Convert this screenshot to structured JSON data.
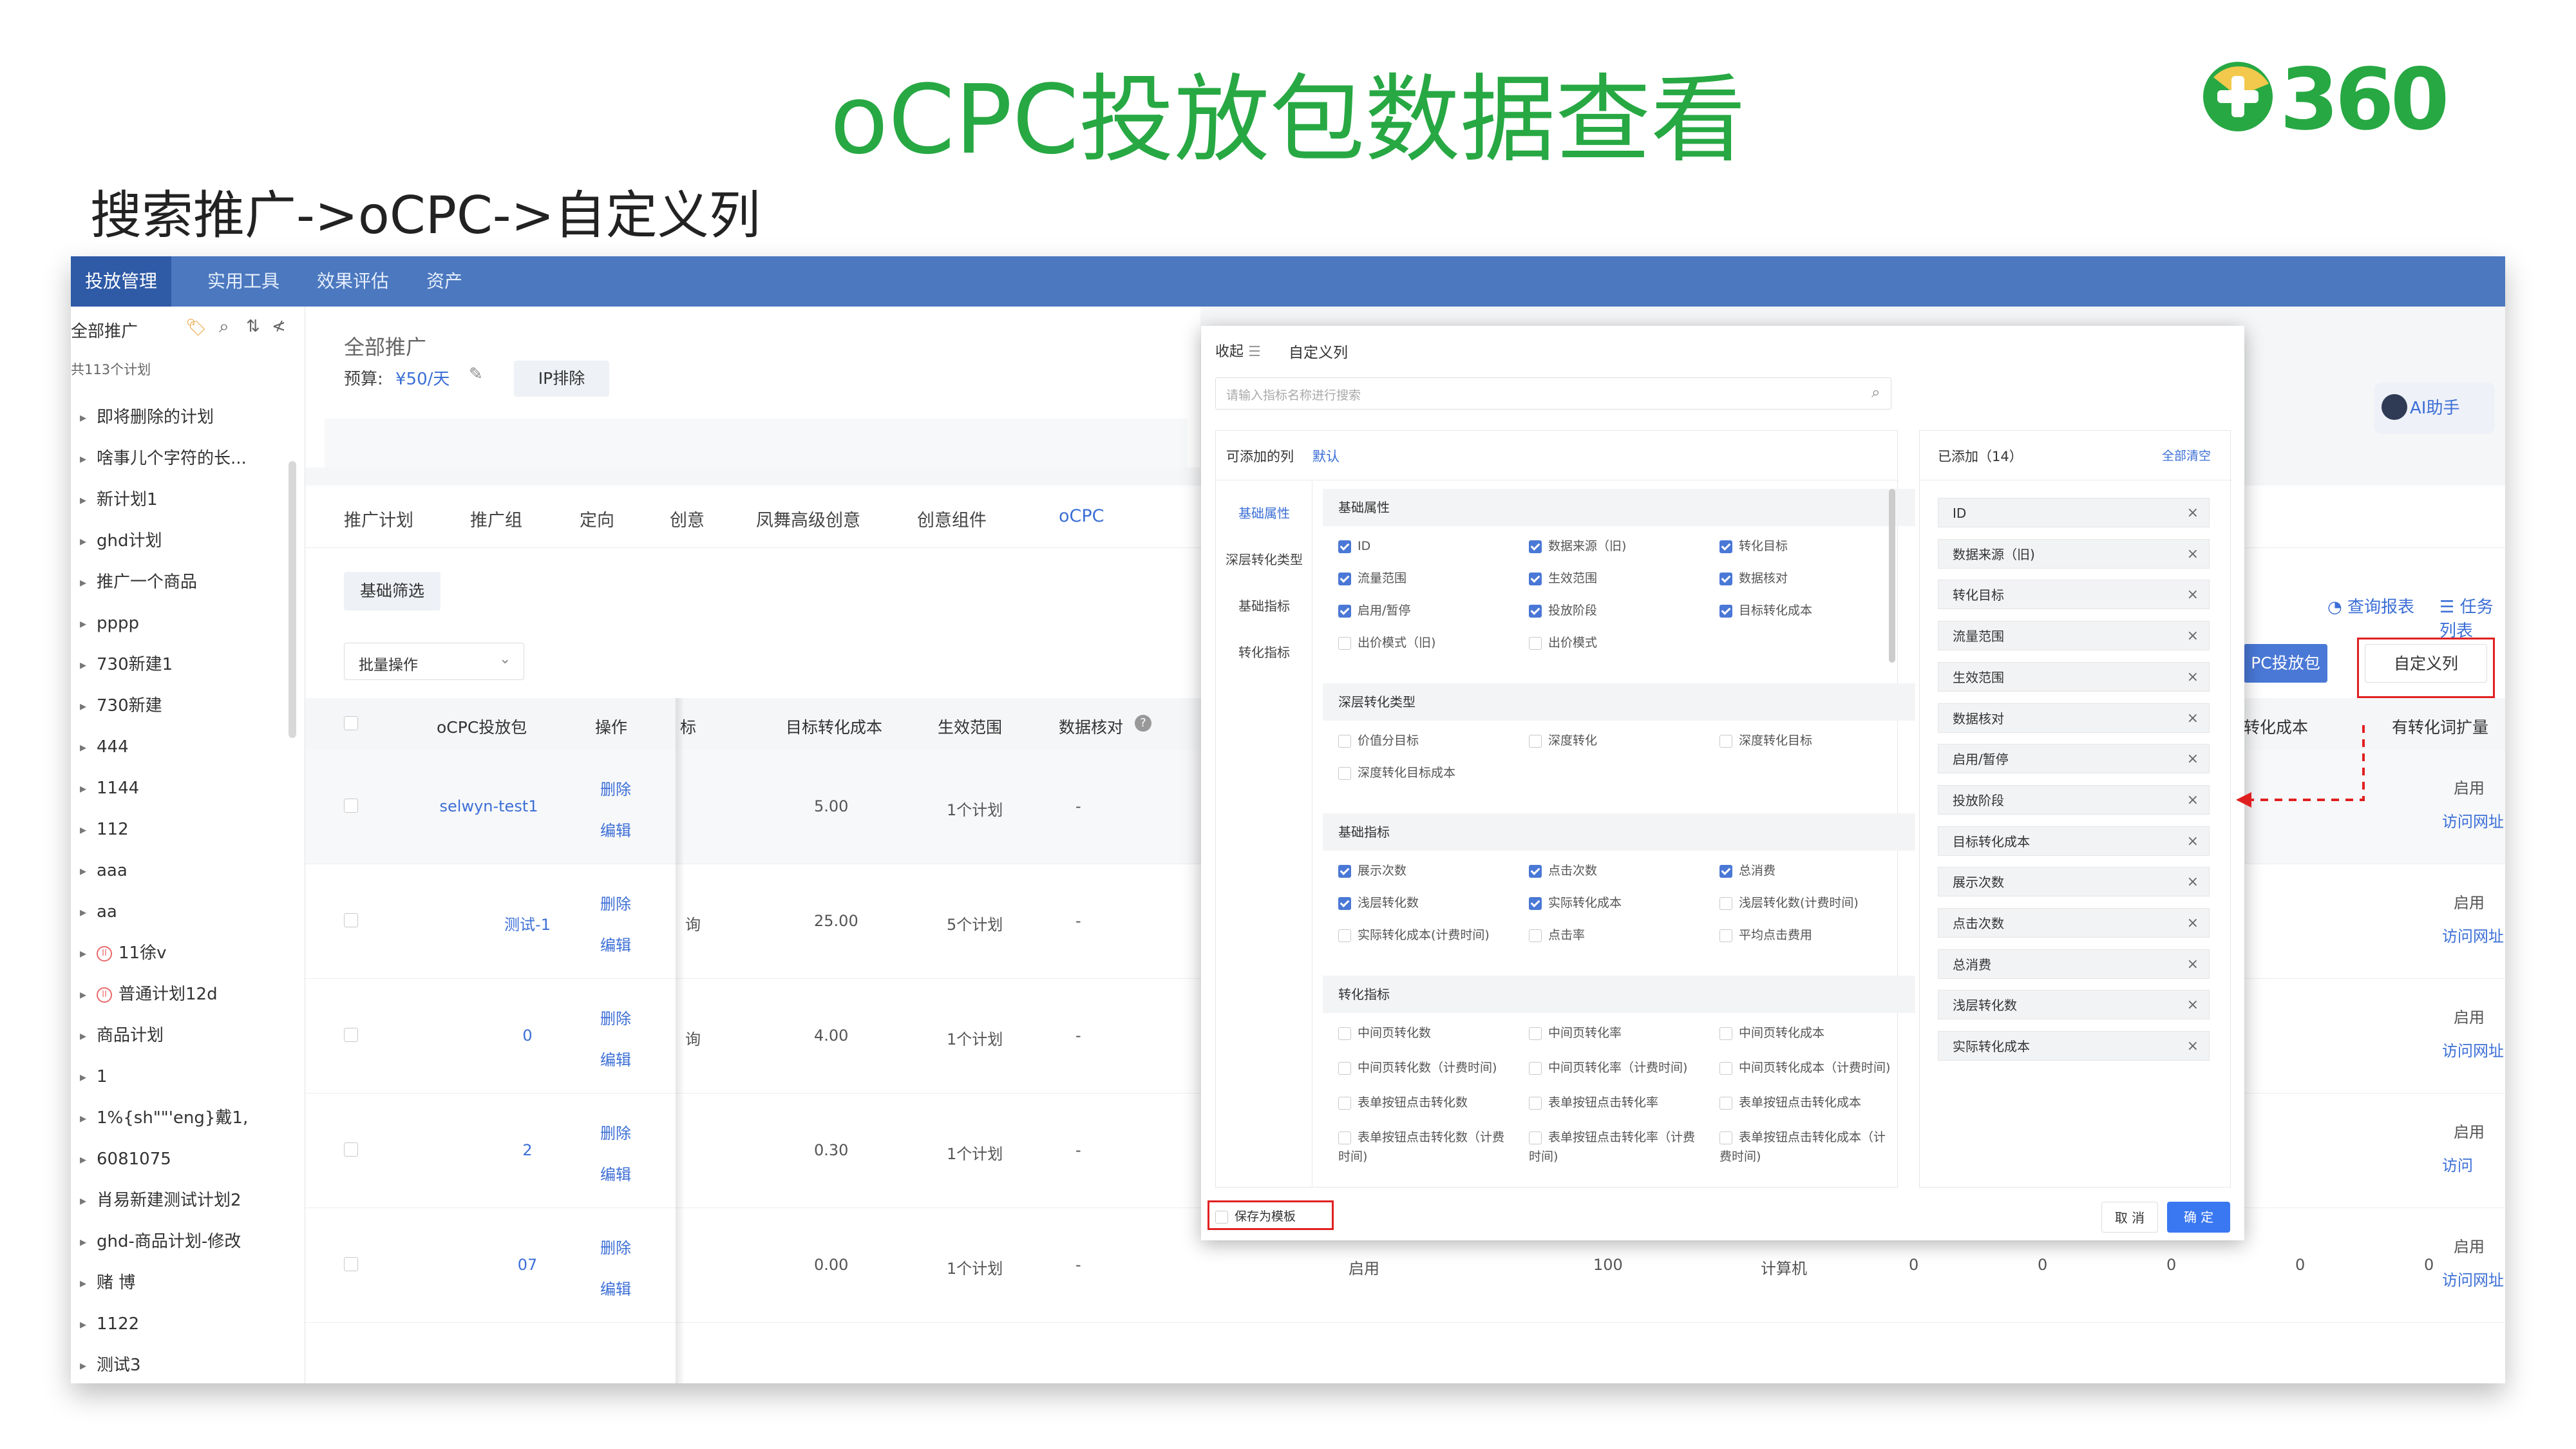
{
  "slide": {
    "title": "oCPC投放包数据查看",
    "logo_text": "360",
    "subtitle": "搜索推广->oCPC->自定义列"
  },
  "topnav": [
    "投放管理",
    "实用工具",
    "效果评估",
    "资产"
  ],
  "sidebar": {
    "title": "全部推广",
    "count": "共113个计划",
    "items": [
      {
        "label": "即将删除的计划"
      },
      {
        "label": "啥事儿个字符的长..."
      },
      {
        "label": "新计划1"
      },
      {
        "label": "ghd计划"
      },
      {
        "label": "推广一个商品"
      },
      {
        "label": "pppp"
      },
      {
        "label": "730新建1"
      },
      {
        "label": "730新建"
      },
      {
        "label": "444"
      },
      {
        "label": "1144"
      },
      {
        "label": "112"
      },
      {
        "label": "aaa"
      },
      {
        "label": "aa"
      },
      {
        "label": "11徐v",
        "paused": true
      },
      {
        "label": "普通计划12d",
        "paused": true
      },
      {
        "label": "商品计划"
      },
      {
        "label": "1"
      },
      {
        "label": "1%{sh\"\"'eng}戴1,"
      },
      {
        "label": "6081075"
      },
      {
        "label": "肖易新建测试计划2"
      },
      {
        "label": "ghd-商品计划-修改"
      },
      {
        "label": "赌 博"
      },
      {
        "label": "1122"
      },
      {
        "label": "测试3"
      }
    ]
  },
  "header": {
    "title": "全部推广",
    "budget_label": "预算:",
    "budget_value": "¥50/天",
    "ip_button": "IP排除"
  },
  "tabs": [
    "推广计划",
    "推广组",
    "定向",
    "创意",
    "凤舞高级创意",
    "创意组件",
    "oCPC"
  ],
  "toolbar": {
    "filter_button": "基础筛选",
    "batch_select": "批量操作",
    "report_link": "查询报表",
    "task_link": "任务列表",
    "ocpc_button": "PC投放包",
    "custom_col_button": "自定义列",
    "ai_button": "AI助手"
  },
  "table": {
    "headers": [
      "oCPC投放包",
      "操作",
      "标",
      "目标转化成本",
      "生效范围",
      "数据核对",
      "转化成本",
      "有转化词扩量"
    ],
    "rows": [
      {
        "name": "selwyn-test1",
        "cost": "5.00",
        "scope": "1个计划",
        "check": "-",
        "status": "启用",
        "extra": "",
        "link": "访问网址"
      },
      {
        "name": "测试-1",
        "cost": "25.00",
        "scope": "5个计划",
        "check": "-",
        "status": "启用",
        "extra": "",
        "link": "访问网址"
      },
      {
        "name": "0",
        "cost": "4.00",
        "scope": "1个计划",
        "check": "-",
        "status": "启用",
        "extra": "",
        "link": "访问网址"
      },
      {
        "name": "2",
        "cost": "0.30",
        "scope": "1个计划",
        "check": "-",
        "status": "启用",
        "extra": "",
        "link": "访问"
      },
      {
        "name": "07",
        "cost": "0.00",
        "scope": "1个计划",
        "check": "-",
        "status": "启用",
        "extra": "",
        "link": "访问网址"
      }
    ],
    "row5_extra": [
      "启用",
      "100",
      "计算机",
      "0",
      "0",
      "0",
      "0",
      "0",
      "-"
    ],
    "delete_label": "删除",
    "edit_label": "编辑",
    "partial_col": [
      "",
      "询",
      "询",
      "",
      ""
    ]
  },
  "modal": {
    "collapse": "收起",
    "title": "自定义列",
    "search_placeholder": "请输入指标名称进行搜索",
    "available_label": "可添加的列",
    "default_link": "默认",
    "added_label": "已添加（14）",
    "clear_all": "全部清空",
    "categories": [
      "基础属性",
      "深层转化类型",
      "基础指标",
      "转化指标"
    ],
    "sections": [
      {
        "title": "基础属性",
        "options": [
          {
            "label": "ID",
            "checked": true
          },
          {
            "label": "数据来源（旧)",
            "checked": true
          },
          {
            "label": "转化目标",
            "checked": true
          },
          {
            "label": "流量范围",
            "checked": true
          },
          {
            "label": "生效范围",
            "checked": true
          },
          {
            "label": "数据核对",
            "checked": true
          },
          {
            "label": "启用/暂停",
            "checked": true
          },
          {
            "label": "投放阶段",
            "checked": true
          },
          {
            "label": "目标转化成本",
            "checked": true
          },
          {
            "label": "出价模式（旧)",
            "checked": false
          },
          {
            "label": "出价模式",
            "checked": false
          }
        ]
      },
      {
        "title": "深层转化类型",
        "options": [
          {
            "label": "价值分目标",
            "checked": false
          },
          {
            "label": "深度转化",
            "checked": false
          },
          {
            "label": "深度转化目标",
            "checked": false
          },
          {
            "label": "深度转化目标成本",
            "checked": false
          }
        ]
      },
      {
        "title": "基础指标",
        "options": [
          {
            "label": "展示次数",
            "checked": true
          },
          {
            "label": "点击次数",
            "checked": true
          },
          {
            "label": "总消费",
            "checked": true
          },
          {
            "label": "浅层转化数",
            "checked": true
          },
          {
            "label": "实际转化成本",
            "checked": true
          },
          {
            "label": "浅层转化数(计费时间)",
            "checked": false
          },
          {
            "label": "实际转化成本(计费时间)",
            "checked": false
          },
          {
            "label": "点击率",
            "checked": false
          },
          {
            "label": "平均点击费用",
            "checked": false
          }
        ]
      },
      {
        "title": "转化指标",
        "options": [
          {
            "label": "中间页转化数",
            "checked": false
          },
          {
            "label": "中间页转化率",
            "checked": false
          },
          {
            "label": "中间页转化成本",
            "checked": false
          },
          {
            "label": "中间页转化数（计费时间)",
            "checked": false
          },
          {
            "label": "中间页转化率（计费时间)",
            "checked": false
          },
          {
            "label": "中间页转化成本（计费时间)",
            "checked": false
          },
          {
            "label": "表单按钮点击转化数",
            "checked": false
          },
          {
            "label": "表单按钮点击转化率",
            "checked": false
          },
          {
            "label": "表单按钮点击转化成本",
            "checked": false
          },
          {
            "label": "表单按钮点击转化数（计费时间)",
            "checked": false
          },
          {
            "label": "表单按钮点击转化率（计费时间)",
            "checked": false
          },
          {
            "label": "表单按钮点击转化成本（计费时间)",
            "checked": false
          }
        ]
      }
    ],
    "added": [
      "ID",
      "数据来源（旧)",
      "转化目标",
      "流量范围",
      "生效范围",
      "数据核对",
      "启用/暂停",
      "投放阶段",
      "目标转化成本",
      "展示次数",
      "点击次数",
      "总消费",
      "浅层转化数",
      "实际转化成本"
    ],
    "save_template": "保存为模板",
    "cancel": "取 消",
    "confirm": "确 定"
  },
  "colors": {
    "brand_green": "#27a843",
    "nav_blue": "#4b78bf",
    "link_blue": "#3c6fd6",
    "highlight_red": "#e02020"
  }
}
